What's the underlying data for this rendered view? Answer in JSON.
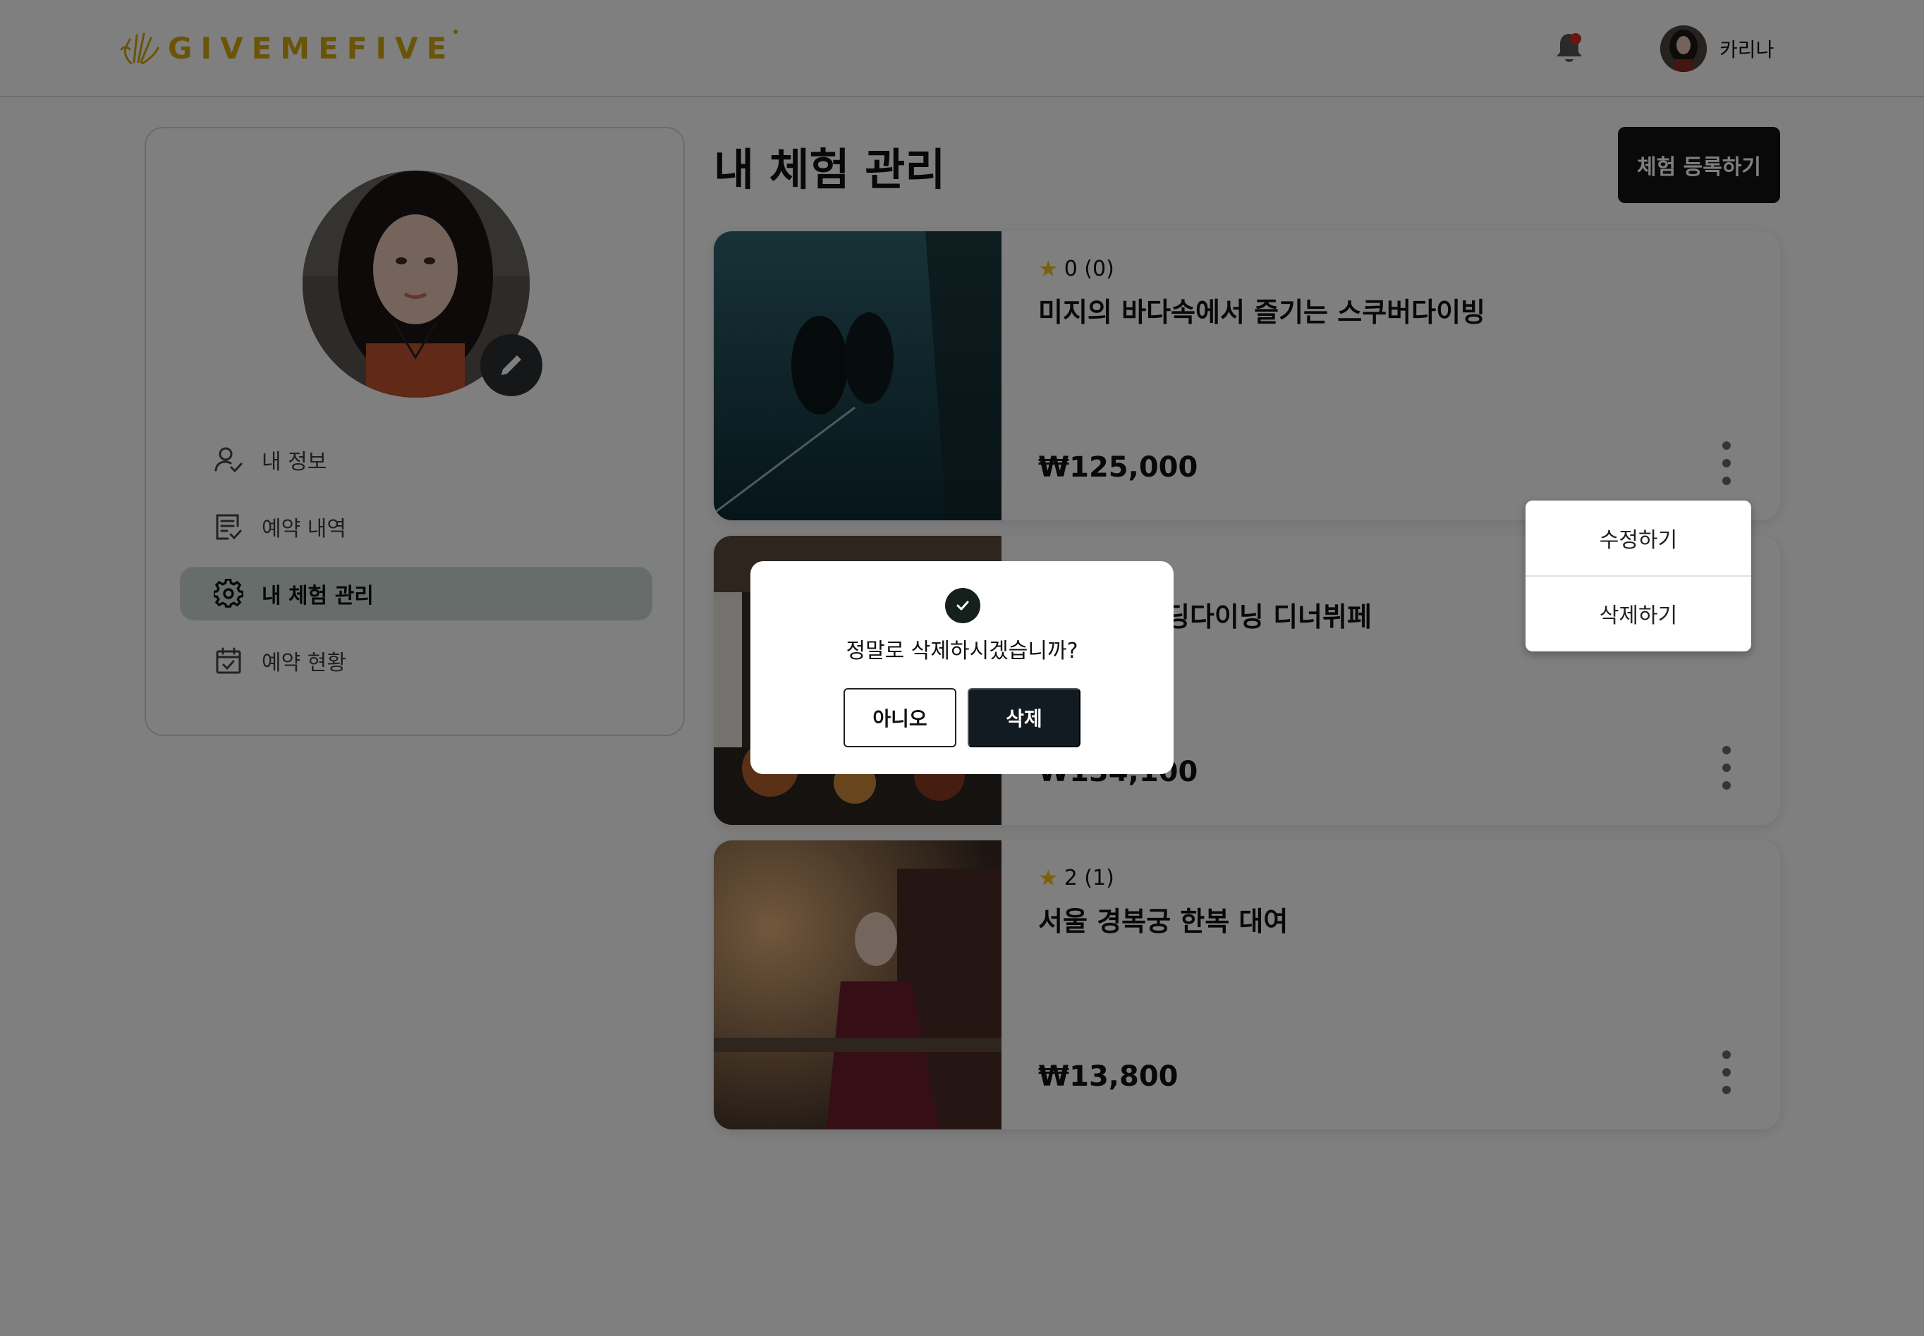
{
  "header": {
    "logo_text": "GIVEMEFIVE",
    "user_name": "카리나"
  },
  "sidebar": {
    "items": [
      {
        "label": "내 정보",
        "icon": "user-check-icon",
        "active": false
      },
      {
        "label": "예약 내역",
        "icon": "list-check-icon",
        "active": false
      },
      {
        "label": "내 체험 관리",
        "icon": "gear-icon",
        "active": true
      },
      {
        "label": "예약 현황",
        "icon": "calendar-check-icon",
        "active": false
      }
    ]
  },
  "main": {
    "title": "내 체험 관리",
    "register_button": "체험 등록하기",
    "cards": [
      {
        "rating": "0 (0)",
        "title": "미지의 바다속에서 즐기는 스쿠버다이빙",
        "price": "₩125,000"
      },
      {
        "rating": "",
        "title": "딩다이닝 디너뷔페",
        "price": "₩134,100"
      },
      {
        "rating": "2 (1)",
        "title": "서울 경복궁 한복 대여",
        "price": "₩13,800"
      }
    ]
  },
  "dropdown": {
    "edit_label": "수정하기",
    "delete_label": "삭제하기"
  },
  "dialog": {
    "message": "정말로 삭제하시겠습니까?",
    "cancel_label": "아니오",
    "confirm_label": "삭제"
  },
  "colors": {
    "accent_gold": "#d4a80f",
    "active_nav_bg": "#cfdad6",
    "dark_button": "#121212",
    "overlay": "rgba(0,0,0,0.5)",
    "notification_dot": "#d62b1e"
  }
}
